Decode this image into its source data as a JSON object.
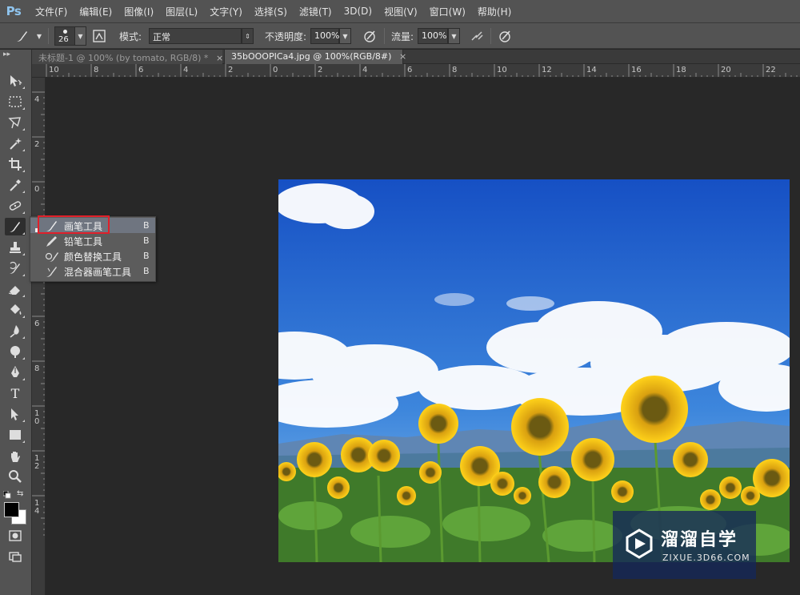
{
  "app": {
    "logo": "Ps"
  },
  "menu": [
    "文件(F)",
    "编辑(E)",
    "图像(I)",
    "图层(L)",
    "文字(Y)",
    "选择(S)",
    "滤镜(T)",
    "3D(D)",
    "视图(V)",
    "窗口(W)",
    "帮助(H)"
  ],
  "options": {
    "brush_size": "26",
    "mode_label": "模式:",
    "mode_value": "正常",
    "opacity_label": "不透明度:",
    "opacity_value": "100%",
    "flow_label": "流量:",
    "flow_value": "100%"
  },
  "tabs": [
    {
      "label": "未标题-1 @ 100% (by tomato, RGB/8) *",
      "close": "×",
      "active": false
    },
    {
      "label": "35bOOOPICa4.jpg @ 100%(RGB/8#)",
      "close": "×",
      "active": true
    }
  ],
  "ruler_h_labels": [
    "10",
    "8",
    "6",
    "4",
    "2",
    "0",
    "2",
    "4",
    "6",
    "8",
    "10",
    "12",
    "14",
    "16",
    "18",
    "20",
    "22"
  ],
  "ruler_v_labels": [
    "4",
    "2",
    "0",
    "2",
    "4",
    "6",
    "8",
    "1\n0",
    "1\n2",
    "1\n4"
  ],
  "toolbox": {
    "grip": "▸▸",
    "tools": [
      "move-tool",
      "marquee-tool",
      "lasso-tool",
      "magic-wand-tool",
      "crop-tool",
      "eyedropper-tool",
      "healing-brush-tool",
      "brush-tool",
      "stamp-tool",
      "history-brush-tool",
      "eraser-tool",
      "paint-bucket-tool",
      "blur-tool",
      "dodge-tool",
      "pen-tool",
      "type-tool",
      "path-selection-tool",
      "rectangle-tool",
      "hand-tool",
      "zoom-tool"
    ],
    "type_tool_glyph": "T"
  },
  "flyout": [
    {
      "label": "画笔工具",
      "key": "B",
      "icon": "brush-icon",
      "selected": true
    },
    {
      "label": "铅笔工具",
      "key": "B",
      "icon": "pencil-icon",
      "selected": false
    },
    {
      "label": "颜色替换工具",
      "key": "B",
      "icon": "color-replacement-icon",
      "selected": false
    },
    {
      "label": "混合器画笔工具",
      "key": "B",
      "icon": "mixer-brush-icon",
      "selected": false
    }
  ],
  "colors": {
    "foreground": "#000000",
    "background": "#ffffff",
    "highlight": "#e0202a",
    "sky_top": "#1a56c8",
    "sky_bottom": "#5aa0e4"
  },
  "watermark": {
    "title": "溜溜自学",
    "url": "ZIXUE.3D66.COM"
  }
}
